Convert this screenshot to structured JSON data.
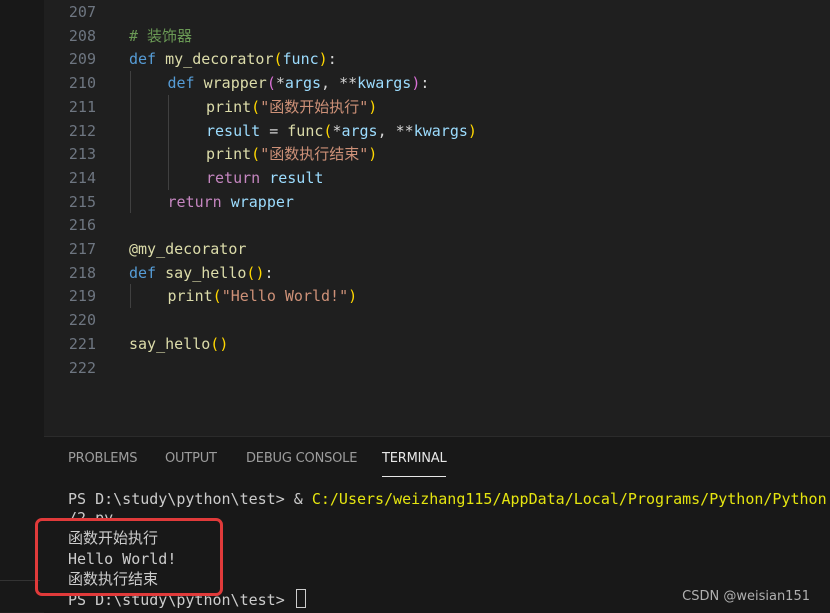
{
  "editor": {
    "lines": [
      {
        "num": "207",
        "tokens": []
      },
      {
        "num": "208",
        "tokens": [
          {
            "t": "# 装饰器",
            "c": "cm"
          }
        ]
      },
      {
        "num": "209",
        "tokens": [
          {
            "t": "def ",
            "c": "kw"
          },
          {
            "t": "my_decorator",
            "c": "fn"
          },
          {
            "t": "(",
            "c": "p1"
          },
          {
            "t": "func",
            "c": "param"
          },
          {
            "t": ")",
            "c": "p1"
          },
          {
            "t": ":",
            "c": "op"
          }
        ]
      },
      {
        "num": "210",
        "indent": 1,
        "tokens": [
          {
            "t": "def ",
            "c": "kw"
          },
          {
            "t": "wrapper",
            "c": "fn"
          },
          {
            "t": "(",
            "c": "p2"
          },
          {
            "t": "*",
            "c": "op"
          },
          {
            "t": "args",
            "c": "param"
          },
          {
            "t": ", ",
            "c": "op"
          },
          {
            "t": "**",
            "c": "op"
          },
          {
            "t": "kwargs",
            "c": "param"
          },
          {
            "t": ")",
            "c": "p2"
          },
          {
            "t": ":",
            "c": "op"
          }
        ]
      },
      {
        "num": "211",
        "indent": 2,
        "tokens": [
          {
            "t": "print",
            "c": "fn"
          },
          {
            "t": "(",
            "c": "p1"
          },
          {
            "t": "\"函数开始执行\"",
            "c": "str"
          },
          {
            "t": ")",
            "c": "p1"
          }
        ]
      },
      {
        "num": "212",
        "indent": 2,
        "tokens": [
          {
            "t": "result",
            "c": "param"
          },
          {
            "t": " = ",
            "c": "op"
          },
          {
            "t": "func",
            "c": "fn"
          },
          {
            "t": "(",
            "c": "p1"
          },
          {
            "t": "*",
            "c": "op"
          },
          {
            "t": "args",
            "c": "param"
          },
          {
            "t": ", ",
            "c": "op"
          },
          {
            "t": "**",
            "c": "op"
          },
          {
            "t": "kwargs",
            "c": "param"
          },
          {
            "t": ")",
            "c": "p1"
          }
        ]
      },
      {
        "num": "213",
        "indent": 2,
        "tokens": [
          {
            "t": "print",
            "c": "fn"
          },
          {
            "t": "(",
            "c": "p1"
          },
          {
            "t": "\"函数执行结束\"",
            "c": "str"
          },
          {
            "t": ")",
            "c": "p1"
          }
        ]
      },
      {
        "num": "214",
        "indent": 2,
        "tokens": [
          {
            "t": "return ",
            "c": "ctl"
          },
          {
            "t": "result",
            "c": "param"
          }
        ]
      },
      {
        "num": "215",
        "indent": 1,
        "tokens": [
          {
            "t": "return ",
            "c": "ctl"
          },
          {
            "t": "wrapper",
            "c": "param"
          }
        ]
      },
      {
        "num": "216",
        "tokens": []
      },
      {
        "num": "217",
        "tokens": [
          {
            "t": "@my_decorator",
            "c": "fn"
          }
        ]
      },
      {
        "num": "218",
        "tokens": [
          {
            "t": "def ",
            "c": "kw"
          },
          {
            "t": "say_hello",
            "c": "fn"
          },
          {
            "t": "(",
            "c": "p1"
          },
          {
            "t": ")",
            "c": "p1"
          },
          {
            "t": ":",
            "c": "op"
          }
        ]
      },
      {
        "num": "219",
        "indent": 1,
        "tokens": [
          {
            "t": "print",
            "c": "fn"
          },
          {
            "t": "(",
            "c": "p1"
          },
          {
            "t": "\"Hello World!\"",
            "c": "str"
          },
          {
            "t": ")",
            "c": "p1"
          }
        ]
      },
      {
        "num": "220",
        "tokens": []
      },
      {
        "num": "221",
        "tokens": [
          {
            "t": "say_hello",
            "c": "fn"
          },
          {
            "t": "(",
            "c": "p1"
          },
          {
            "t": ")",
            "c": "p1"
          }
        ]
      },
      {
        "num": "222",
        "tokens": []
      }
    ]
  },
  "panel": {
    "tabs": [
      {
        "label": "PROBLEMS",
        "active": false
      },
      {
        "label": "OUTPUT",
        "active": false
      },
      {
        "label": "DEBUG CONSOLE",
        "active": false
      },
      {
        "label": "TERMINAL",
        "active": true
      }
    ]
  },
  "terminal": {
    "prompt1": "PS D:\\study\\python\\test> & ",
    "cmd_path": "C:/Users/weizhang115/AppData/Local/Programs/Python/Python",
    "wrap": "/2.py",
    "out1": "函数开始执行",
    "out2": "Hello World!",
    "out3": "函数执行结束",
    "prompt2": "PS D:\\study\\python\\test> "
  },
  "watermark": "CSDN @weisian151",
  "colors": {
    "highlight_box": "#e03a3a",
    "background": "#1f1f1f"
  }
}
